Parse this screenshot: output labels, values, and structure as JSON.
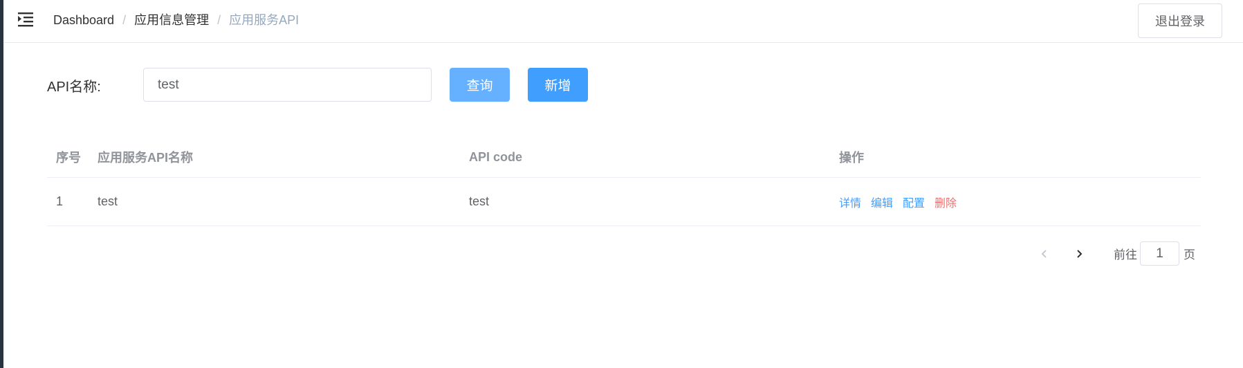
{
  "navbar": {
    "breadcrumb": [
      "Dashboard",
      "应用信息管理",
      "应用服务API"
    ],
    "separator": "/",
    "logout_label": "退出登录"
  },
  "search": {
    "label": "API名称:",
    "value": "test",
    "query_label": "查询",
    "add_label": "新增"
  },
  "table": {
    "headers": [
      "序号",
      "应用服务API名称",
      "API code",
      "操作"
    ],
    "rows": [
      {
        "index": "1",
        "name": "test",
        "code": "test",
        "actions": [
          "详情",
          "编辑",
          "配置",
          "删除"
        ]
      }
    ]
  },
  "pagination": {
    "goto_label": "前往",
    "page_value": "1",
    "suffix": "页"
  },
  "colors": {
    "primary": "#409eff",
    "primary_light": "#66b1ff",
    "danger": "#f56c6c",
    "sidebar": "#2b3240"
  },
  "icons": {
    "hamburger": "menu-fold-icon",
    "prev": "chevron-left-icon",
    "next": "chevron-right-icon"
  }
}
